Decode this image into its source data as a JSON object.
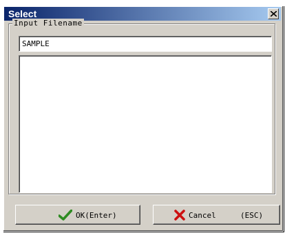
{
  "window": {
    "title": "Select"
  },
  "group": {
    "label": "Input Filename"
  },
  "filename": {
    "value": "SAMPLE"
  },
  "file_list": {
    "items": []
  },
  "buttons": {
    "ok": {
      "label": "OK(Enter)",
      "icon": "check-icon",
      "icon_color": "#2e8b22"
    },
    "cancel": {
      "label": "Cancel",
      "shortcut": "(ESC)",
      "icon": "x-icon",
      "icon_color": "#cc1010"
    }
  },
  "colors": {
    "titlebar_start": "#0a246a",
    "titlebar_end": "#a6caf0",
    "face": "#d4d0c8"
  }
}
